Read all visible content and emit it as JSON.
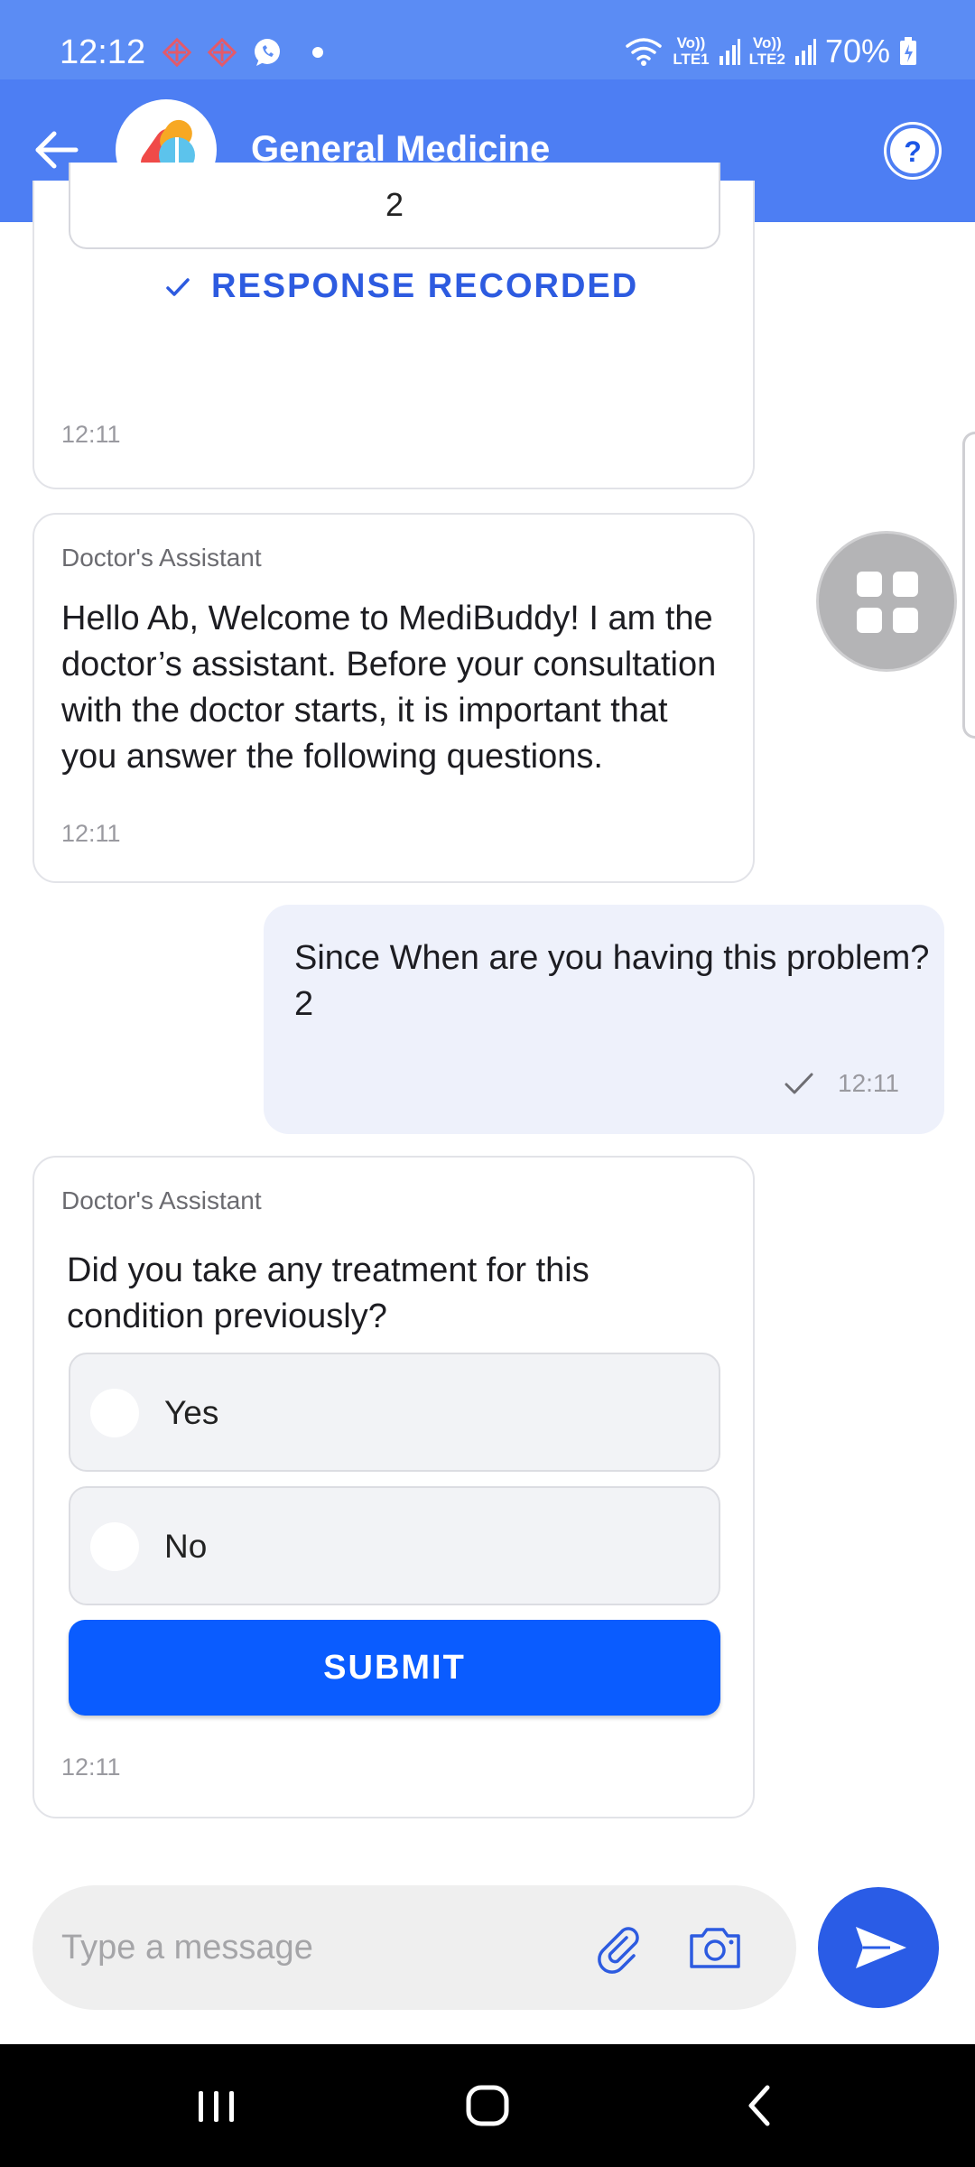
{
  "status_bar": {
    "time": "12:12",
    "battery": "70%",
    "net1_top": "Vo))",
    "net1_bottom": "LTE1",
    "net2_top": "Vo))",
    "net2_bottom": "LTE2",
    "icons": [
      "app-notification-icon",
      "app-notification-icon",
      "whatsapp-icon",
      "wifi-icon",
      "signal-icon",
      "battery-icon"
    ]
  },
  "header": {
    "title": "General Medicine",
    "help_label": "?"
  },
  "chat": {
    "prev_card": {
      "answer": "2",
      "status": "RESPONSE RECORDED",
      "time": "12:11"
    },
    "welcome": {
      "sender": "Doctor's Assistant",
      "text": "Hello Ab, Welcome to MediBuddy! I am the doctor’s assistant. Before your consultation with the doctor starts, it is important that you answer the following questions.",
      "time": "12:11"
    },
    "user_message": {
      "line1": "Since When are you having this problem?",
      "line2": "2",
      "time": "12:11"
    },
    "question": {
      "sender": "Doctor's Assistant",
      "text": "Did you take any treatment for this condition previously?",
      "options": [
        "Yes",
        "No"
      ],
      "submit_label": "SUBMIT",
      "time": "12:11"
    }
  },
  "composer": {
    "placeholder": "Type a message"
  },
  "colors": {
    "status_bar": "#5b8cf4",
    "app_bar": "#4d7ef3",
    "accent": "#2d5be0",
    "submit": "#0a5cff",
    "user_bubble": "#eef1fb"
  }
}
